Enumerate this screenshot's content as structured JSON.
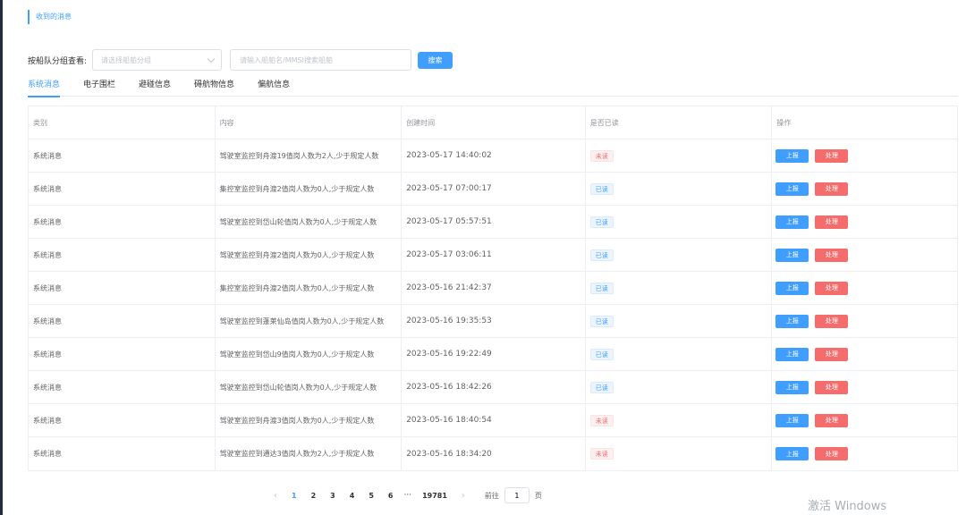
{
  "section_title": "收到的消息",
  "filter": {
    "label": "按船队分组查看:",
    "select_placeholder": "请选择船舶分组",
    "input_placeholder": "请输入船舶名/MMSI搜索船舶",
    "search_label": "搜索"
  },
  "tabs": [
    {
      "label": "系统消息",
      "active": true
    },
    {
      "label": "电子围栏",
      "active": false
    },
    {
      "label": "避碰信息",
      "active": false
    },
    {
      "label": "碍航物信息",
      "active": false
    },
    {
      "label": "偏航信息",
      "active": false
    }
  ],
  "table": {
    "headers": [
      "类别",
      "内容",
      "创建时间",
      "是否已读",
      "操作"
    ],
    "rows": [
      {
        "category": "系统消息",
        "content": "驾驶室监控到舟渡19值岗人数为2人,少于规定人数",
        "time": "2023-05-17 14:40:02",
        "status": "未读",
        "read": false
      },
      {
        "category": "系统消息",
        "content": "集控室监控到舟渡2值岗人数为0人,少于规定人数",
        "time": "2023-05-17 07:00:17",
        "status": "已读",
        "read": true
      },
      {
        "category": "系统消息",
        "content": "驾驶室监控到岱山轮值岗人数为0人,少于规定人数",
        "time": "2023-05-17 05:57:51",
        "status": "已读",
        "read": true
      },
      {
        "category": "系统消息",
        "content": "驾驶室监控到舟渡2值岗人数为0人,少于规定人数",
        "time": "2023-05-17 03:06:11",
        "status": "已读",
        "read": true
      },
      {
        "category": "系统消息",
        "content": "集控室监控到舟渡2值岗人数为0人,少于规定人数",
        "time": "2023-05-16 21:42:37",
        "status": "已读",
        "read": true
      },
      {
        "category": "系统消息",
        "content": "驾驶室监控到蓬莱仙岛值岗人数为0人,少于规定人数",
        "time": "2023-05-16 19:35:53",
        "status": "已读",
        "read": true
      },
      {
        "category": "系统消息",
        "content": "驾驶室监控到岱山9值岗人数为0人,少于规定人数",
        "time": "2023-05-16 19:22:49",
        "status": "已读",
        "read": true
      },
      {
        "category": "系统消息",
        "content": "驾驶室监控到岱山轮值岗人数为0人,少于规定人数",
        "time": "2023-05-16 18:42:26",
        "status": "已读",
        "read": true
      },
      {
        "category": "系统消息",
        "content": "驾驶室监控到舟渡3值岗人数为0人,少于规定人数",
        "time": "2023-05-16 18:40:54",
        "status": "未读",
        "read": false
      },
      {
        "category": "系统消息",
        "content": "驾驶室监控到通达3值岗人数为2人,少于规定人数",
        "time": "2023-05-16 18:34:20",
        "status": "未读",
        "read": false
      }
    ],
    "report_label": "上报",
    "handle_label": "处理"
  },
  "pagination": {
    "pages": [
      "1",
      "2",
      "3",
      "4",
      "5",
      "6"
    ],
    "current": "1",
    "more": "···",
    "last": "19781",
    "goto_prefix": "前往",
    "goto_value": "1",
    "goto_suffix": "页"
  },
  "watermark": "激活 Windows"
}
